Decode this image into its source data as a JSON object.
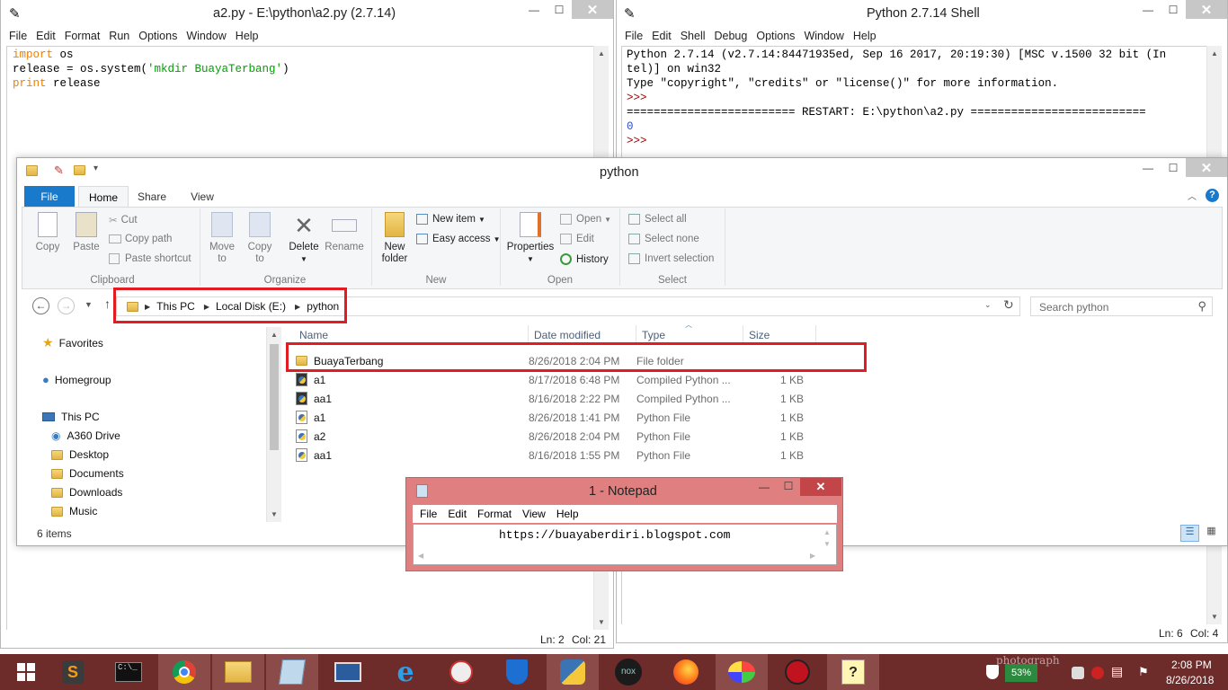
{
  "editor": {
    "title": "a2.py - E:\\python\\a2.py (2.7.14)",
    "menu": [
      "File",
      "Edit",
      "Format",
      "Run",
      "Options",
      "Window",
      "Help"
    ],
    "lines": [
      {
        "kw": "import",
        "rest": " os"
      },
      {
        "pre": "release = os.system(",
        "str": "'mkdir BuayaTerbang'",
        "post": ")"
      },
      {
        "kw": "print",
        "rest": " release"
      }
    ],
    "status": {
      "ln": "Ln: 2",
      "col": "Col: 21"
    }
  },
  "shell": {
    "title": "Python 2.7.14 Shell",
    "menu": [
      "File",
      "Edit",
      "Shell",
      "Debug",
      "Options",
      "Window",
      "Help"
    ],
    "line1": "Python 2.7.14 (v2.7.14:84471935ed, Sep 16 2017, 20:19:30) [MSC v.1500 32 bit (In",
    "line2": "tel)] on win32",
    "line3": "Type \"copyright\", \"credits\" or \"license()\" for more information.",
    "prompt": ">>>",
    "restart": "========================= RESTART: E:\\python\\a2.py ==========================",
    "output": "0",
    "status": {
      "ln": "Ln: 6",
      "col": "Col: 4"
    }
  },
  "explorer": {
    "title": "python",
    "tabs": {
      "file": "File",
      "home": "Home",
      "share": "Share",
      "view": "View"
    },
    "ribbon": {
      "copy": "Copy",
      "paste": "Paste",
      "cut": "Cut",
      "copy_path": "Copy path",
      "paste_shortcut": "Paste shortcut",
      "move_to": "Move",
      "move_to2": "to",
      "copy_to": "Copy",
      "copy_to2": "to",
      "delete": "Delete",
      "rename": "Rename",
      "new_folder": "New",
      "new_folder2": "folder",
      "new_item": "New item",
      "easy_access": "Easy access",
      "properties": "Properties",
      "open": "Open",
      "edit": "Edit",
      "history": "History",
      "select_all": "Select all",
      "select_none": "Select none",
      "invert_selection": "Invert selection",
      "groups": {
        "clipboard": "Clipboard",
        "organize": "Organize",
        "new": "New",
        "open": "Open",
        "select": "Select"
      }
    },
    "breadcrumb": [
      "This PC",
      "Local Disk (E:)",
      "python"
    ],
    "search_placeholder": "Search python",
    "nav": {
      "favorites": "Favorites",
      "homegroup": "Homegroup",
      "this_pc": "This PC",
      "items": [
        "A360 Drive",
        "Desktop",
        "Documents",
        "Downloads",
        "Music"
      ]
    },
    "columns": {
      "name": "Name",
      "date": "Date modified",
      "type": "Type",
      "size": "Size"
    },
    "files": [
      {
        "name": "BuayaTerbang",
        "date": "8/26/2018 2:04 PM",
        "type": "File folder",
        "size": "",
        "icon": "folder"
      },
      {
        "name": "a1",
        "date": "8/17/2018 6:48 PM",
        "type": "Compiled Python ...",
        "size": "1 KB",
        "icon": "pyc"
      },
      {
        "name": "aa1",
        "date": "8/16/2018 2:22 PM",
        "type": "Compiled Python ...",
        "size": "1 KB",
        "icon": "pyc"
      },
      {
        "name": "a1",
        "date": "8/26/2018 1:41 PM",
        "type": "Python File",
        "size": "1 KB",
        "icon": "py"
      },
      {
        "name": "a2",
        "date": "8/26/2018 2:04 PM",
        "type": "Python File",
        "size": "1 KB",
        "icon": "py"
      },
      {
        "name": "aa1",
        "date": "8/16/2018 1:55 PM",
        "type": "Python File",
        "size": "1 KB",
        "icon": "py"
      }
    ],
    "item_count": "6 items"
  },
  "notepad": {
    "title": "1 - Notepad",
    "menu": [
      "File",
      "Edit",
      "Format",
      "View",
      "Help"
    ],
    "text": "https://buayaberdiri.blogspot.com"
  },
  "taskbar": {
    "battery": "53%",
    "time": "2:08 PM",
    "date": "8/26/2018",
    "watermark": "photograph"
  },
  "colors": {
    "highlight": "#e31c23",
    "taskbar": "#6d2b2a",
    "notepad_frame": "#e07f80",
    "file_tab": "#1979ca"
  }
}
